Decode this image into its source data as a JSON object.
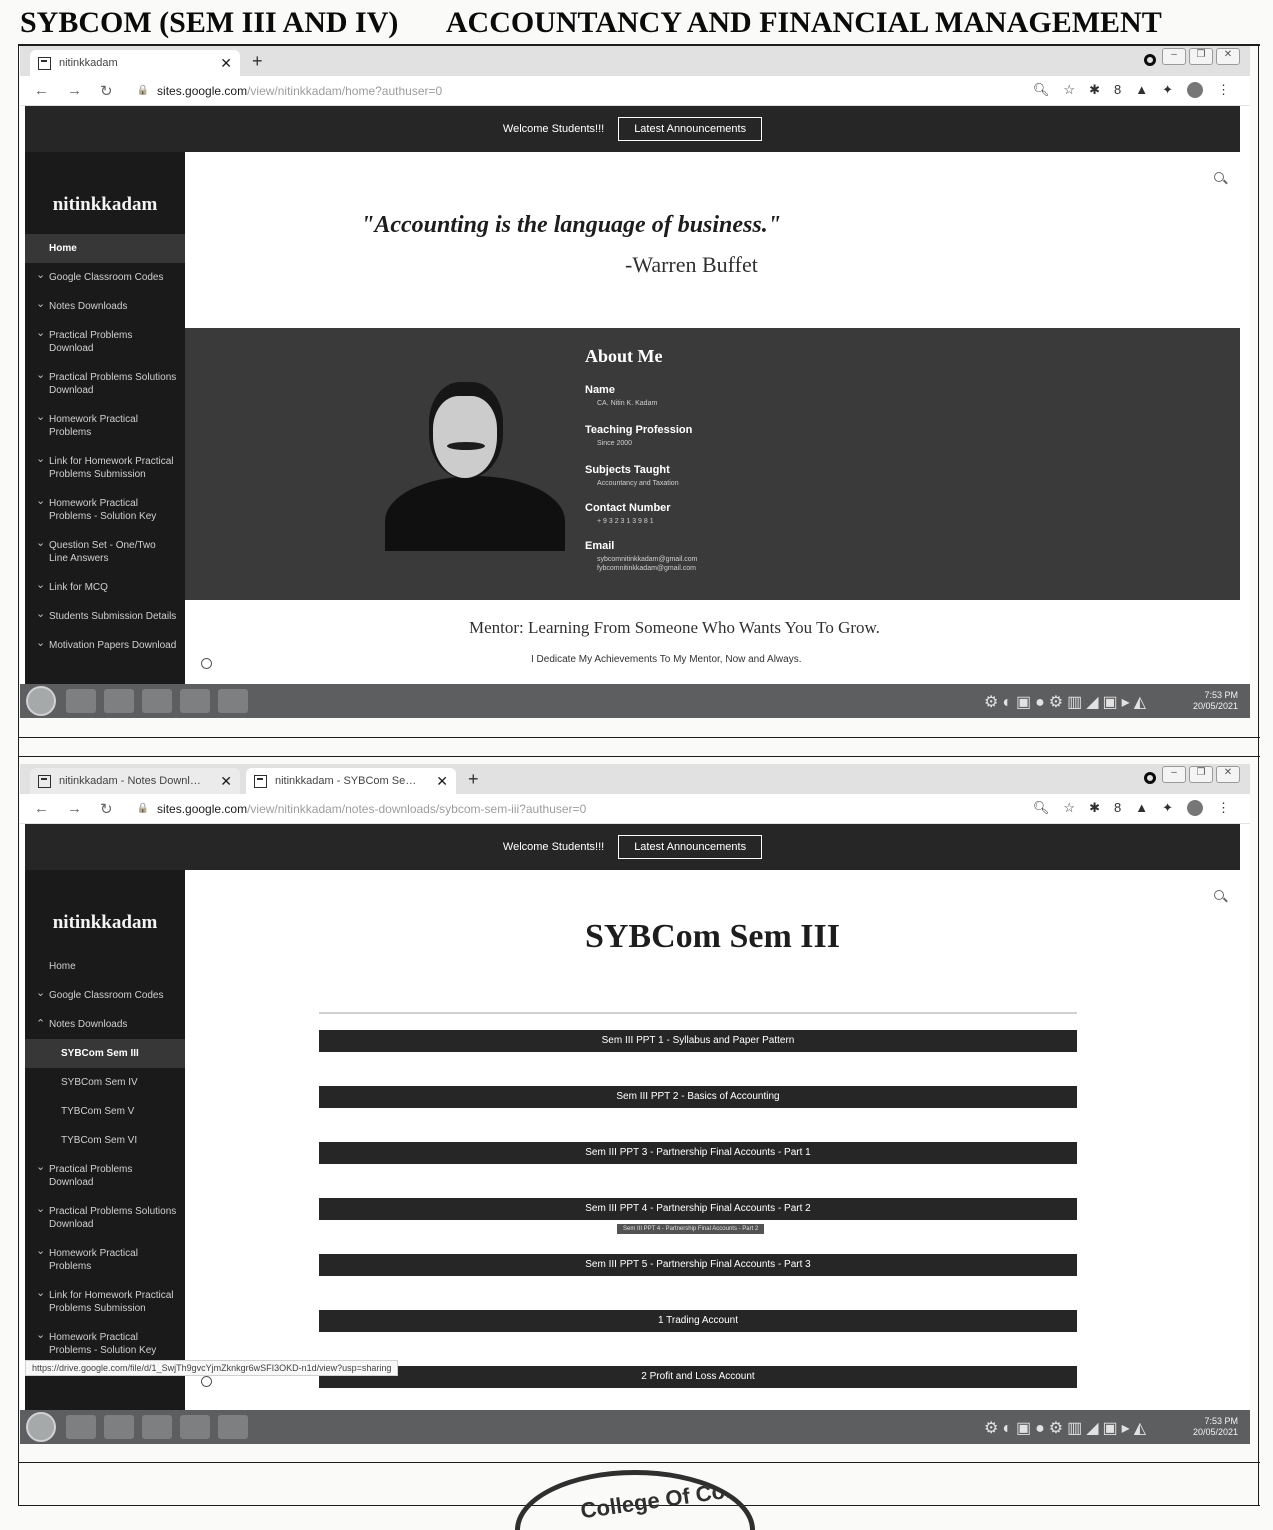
{
  "document": {
    "title_left": "SYBCOM (SEM III AND IV)",
    "title_right": "ACCOUNTANCY AND FINANCIAL MANAGEMENT"
  },
  "screen1": {
    "tabs": [
      {
        "label": "nitinkkadam"
      }
    ],
    "new_tab": "+",
    "url": {
      "host": "sites.google.com",
      "path": "/view/nitinkkadam/home?authuser=0"
    },
    "site": {
      "welcome": "Welcome Students!!!",
      "announce": "Latest Announcements",
      "brand": "nitinkkadam",
      "nav": [
        {
          "label": "Home",
          "active": true
        },
        {
          "label": "Google Classroom Codes",
          "chev": true
        },
        {
          "label": "Notes Downloads",
          "chev": true
        },
        {
          "label": "Practical Problems Download",
          "chev": true
        },
        {
          "label": "Practical Problems Solutions Download",
          "chev": true
        },
        {
          "label": "Homework Practical Problems",
          "chev": true
        },
        {
          "label": "Link for Homework Practical Problems Submission",
          "chev": true
        },
        {
          "label": "Homework Practical Problems - Solution Key",
          "chev": true
        },
        {
          "label": "Question Set - One/Two Line Answers",
          "chev": true
        },
        {
          "label": "Link for MCQ",
          "chev": true
        },
        {
          "label": "Students Submission Details",
          "chev": true
        },
        {
          "label": "Motivation Papers Download",
          "chev": true
        }
      ],
      "quote": "\"Accounting is the language of business.\"",
      "author": "-Warren Buffet",
      "about": {
        "title": "About Me",
        "name_label": "Name",
        "name_value": "CA. Nitin K. Kadam",
        "profession_label": "Teaching Profession",
        "profession_value": "Since 2000",
        "subjects_label": "Subjects Taught",
        "subjects_value": "Accountancy and Taxation",
        "contact_label": "Contact Number",
        "contact_value": "+ 9 3 2 3 1 3 9 8 1",
        "email_label": "Email",
        "email_value": "sybcomnitinkkadam@gmail.com",
        "email_value2": "fybcomnitinkkadam@gmail.com"
      },
      "mentor": "Mentor: Learning From Someone Who Wants You To Grow.",
      "dedicate": "I Dedicate My Achievements To My Mentor, Now and Always."
    },
    "clock": {
      "time": "7:53 PM",
      "date": "20/05/2021"
    }
  },
  "screen2": {
    "tabs": [
      {
        "label": "nitinkkadam - Notes Downloads"
      },
      {
        "label": "nitinkkadam - SYBCom Sem III"
      }
    ],
    "new_tab": "+",
    "url": {
      "host": "sites.google.com",
      "path": "/view/nitinkkadam/notes-downloads/sybcom-sem-iii?authuser=0"
    },
    "site": {
      "welcome": "Welcome Students!!!",
      "announce": "Latest Announcements",
      "brand": "nitinkkadam",
      "nav": [
        {
          "label": "Home"
        },
        {
          "label": "Google Classroom Codes",
          "chev": true
        },
        {
          "label": "Notes Downloads",
          "up": true
        },
        {
          "label": "SYBCom Sem III",
          "active": true,
          "sub": true
        },
        {
          "label": "SYBCom Sem IV",
          "sub": true
        },
        {
          "label": "TYBCom Sem V",
          "sub": true
        },
        {
          "label": "TYBCom Sem VI",
          "sub": true
        },
        {
          "label": "Practical Problems Download",
          "chev": true
        },
        {
          "label": "Practical Problems Solutions Download",
          "chev": true
        },
        {
          "label": "Homework Practical Problems",
          "chev": true
        },
        {
          "label": "Link for Homework Practical Problems Submission",
          "chev": true
        },
        {
          "label": "Homework Practical Problems - Solution Key",
          "chev": true
        }
      ],
      "page_title": "SYBCom Sem III",
      "buttons": [
        "Sem III PPT 1 - Syllabus and Paper Pattern",
        "Sem III PPT 2 - Basics of Accounting",
        "Sem III PPT 3 - Partnership Final Accounts - Part 1",
        "Sem III PPT 4 - Partnership Final Accounts - Part 2",
        "Sem III PPT 5 - Partnership Final Accounts - Part 3",
        "1 Trading Account",
        "2 Profit and Loss Account"
      ],
      "tooltip": "Sem III PPT 4 - Partnership Final Accounts - Part 2"
    },
    "status_url": "https://drive.google.com/file/d/1_SwjTh9gvcYjmZknkgr6wSFI3OKD-n1d/view?usp=sharing",
    "clock": {
      "time": "7:53 PM",
      "date": "20/05/2021"
    }
  },
  "seal": {
    "text": "College Of Com"
  }
}
